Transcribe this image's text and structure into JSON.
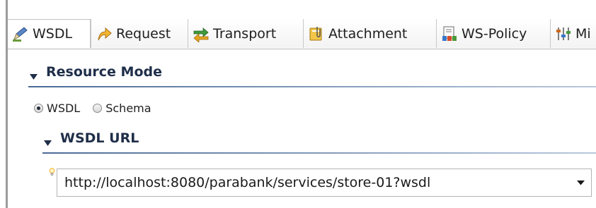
{
  "tabs": [
    {
      "id": "wsdl",
      "label": "WSDL",
      "icon": "wsdl-edit-icon",
      "active": true
    },
    {
      "id": "request",
      "label": "Request",
      "icon": "request-arrow-icon",
      "active": false
    },
    {
      "id": "transport",
      "label": "Transport",
      "icon": "transport-arrows-icon",
      "active": false
    },
    {
      "id": "attachment",
      "label": "Attachment",
      "icon": "attachment-clip-icon",
      "active": false
    },
    {
      "id": "wspolicy",
      "label": "WS-Policy",
      "icon": "ws-policy-icon",
      "active": false
    },
    {
      "id": "misc",
      "label": "Mi",
      "icon": "misc-sliders-icon",
      "active": false
    }
  ],
  "resource_mode": {
    "title": "Resource Mode",
    "options": [
      {
        "label": "WSDL",
        "selected": true
      },
      {
        "label": "Schema",
        "selected": false
      }
    ]
  },
  "wsdl_url": {
    "title": "WSDL URL",
    "value": "http://localhost:8080/parabank/services/store-01?wsdl"
  },
  "colors": {
    "section_title": "#1f2e49",
    "section_rule": "#4a6a96",
    "hint_bulb": "#f0b020"
  }
}
